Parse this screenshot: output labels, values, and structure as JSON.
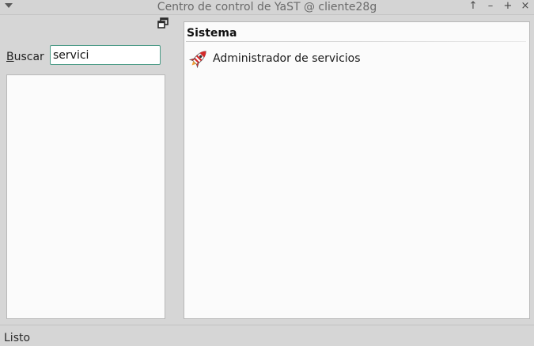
{
  "window": {
    "title": "Centro de control de YaST @ cliente28g",
    "controls": {
      "menu_icon": "chevron-down-icon",
      "keep_above": "↑",
      "minimize": "–",
      "maximize": "+",
      "close": "×"
    }
  },
  "search": {
    "label_accel": "B",
    "label_rest": "uscar",
    "value": "servici"
  },
  "categories": [
    {
      "title": "Sistema",
      "modules": [
        {
          "label": "Administrador de servicios",
          "icon": "rocket-icon"
        }
      ]
    }
  ],
  "status": {
    "text": "Listo"
  },
  "colors": {
    "window_bg": "#d6d6d6",
    "panel_bg": "#fbfbfb",
    "focus_border": "#4a9a86",
    "icon_red": "#d42a2a"
  }
}
